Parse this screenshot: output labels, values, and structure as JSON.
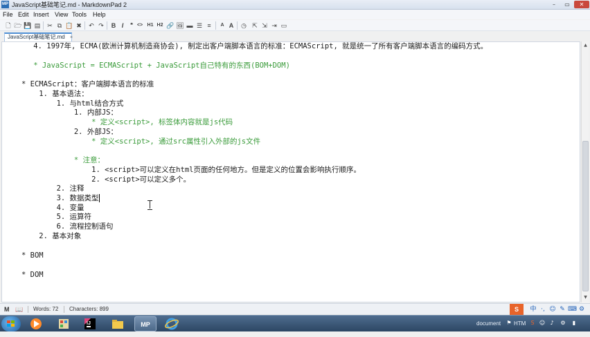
{
  "window": {
    "title": "JavaScript基础笔记.md - MarkdownPad 2",
    "app_icon": "MP",
    "minimize": "–",
    "maximize": "▭",
    "close": "✕"
  },
  "menu": [
    "File",
    "Edit",
    "Insert",
    "View",
    "Tools",
    "Help"
  ],
  "toolbar": {
    "h1": "H1",
    "h2": "H2",
    "bold": "B",
    "italic": "I",
    "quote": "❝",
    "code": "<>",
    "font_small": "A",
    "font_large": "A"
  },
  "tab": {
    "label": "JavaScript基础笔记.md",
    "close": "×"
  },
  "editor": {
    "lines": [
      "    4. 1997年, ECMA(欧洲计算机制造商协会), 制定出客户端脚本语言的标准：ECMAScript, 就是统一了所有客户端脚本语言的编码方式。",
      "    * JavaScript = ECMAScript + JavaScript自己特有的东西(BOM+DOM)",
      "* ECMAScript：客户端脚本语言的标准",
      "    1. 基本语法：",
      "        1. 与html结合方式",
      "            1. 内部JS：",
      "                * 定义<script>, 标签体内容就是js代码",
      "            2. 外部JS：",
      "                * 定义<script>, 通过src属性引入外部的js文件",
      "            * 注意：",
      "                1. <script>可以定义在html页面的任何地方。但是定义的位置会影响执行顺序。",
      "                2. <script>可以定义多个。",
      "        2. 注释",
      "        3. 数据类型",
      "        4. 变量",
      "        5. 运算符",
      "        6. 流程控制语句",
      "    2. 基本对象",
      "* BOM",
      "* DOM"
    ]
  },
  "status": {
    "words": "Words: 72",
    "characters": "Characters: 899",
    "markdown_icon": "M",
    "book_icon": "📖"
  },
  "ime": {
    "logo": "S",
    "lang": "中"
  },
  "taskbar": {
    "mp_label": "MP",
    "tray_text": "document",
    "tray_htm": "HTM"
  },
  "colors": {
    "accent": "#4d8ed4",
    "green_text": "#3a9b3a",
    "ime_orange": "#e8642a"
  }
}
